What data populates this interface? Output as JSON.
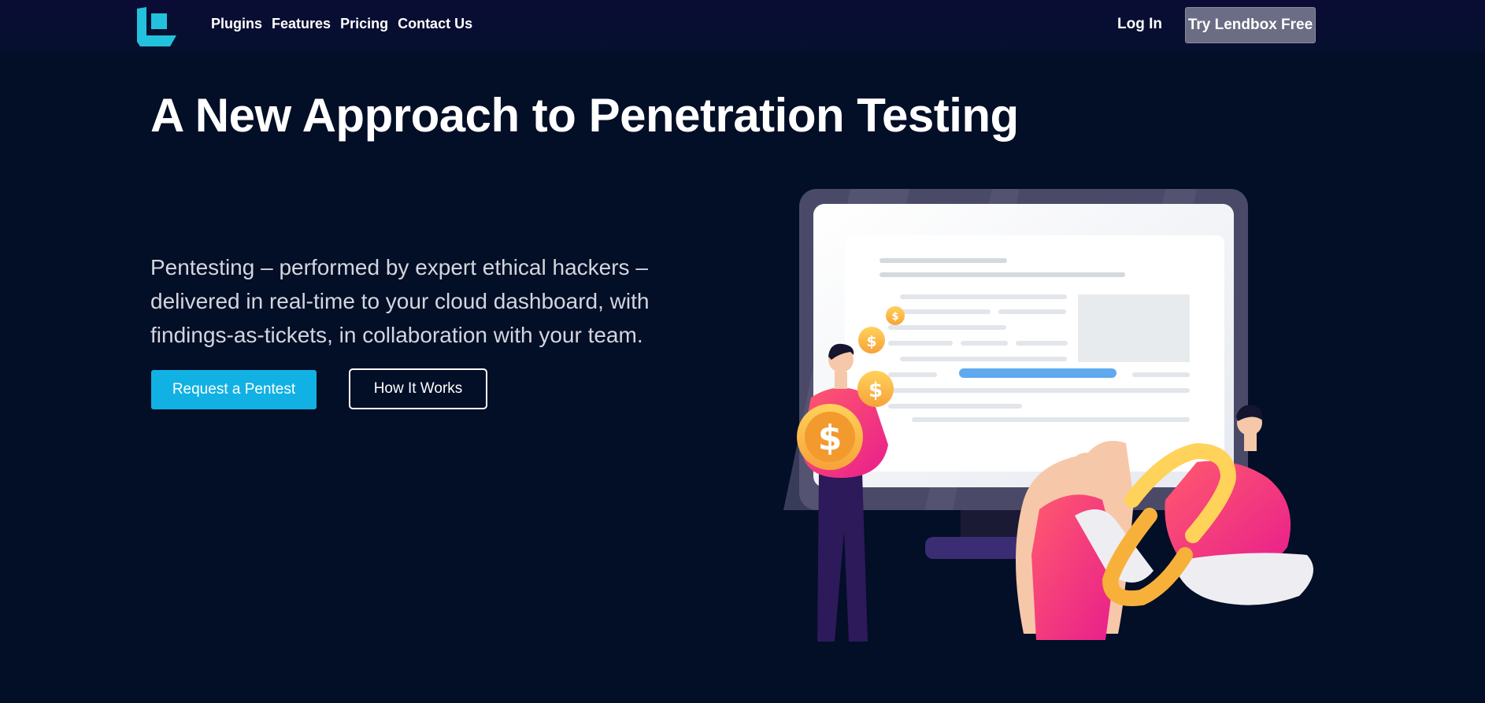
{
  "header": {
    "nav": [
      "Plugins",
      "Features",
      "Pricing",
      "Contact Us"
    ],
    "login_label": "Log In",
    "cta_label": "Try Lendbox Free"
  },
  "hero": {
    "title": "A New Approach to Penetration Testing",
    "subtitle": "Pentesting – performed by expert ethical hackers – delivered in real-time to your cloud dashboard, with findings-as-tickets, in collaboration with your team.",
    "primary_button": "Request a Pentest",
    "secondary_button": "How It Works"
  },
  "illustration": {
    "coin_symbol": "$"
  },
  "colors": {
    "background": "#030e27",
    "accent": "#11b1e3",
    "logo": "#22c2dc",
    "cta_background": "#6b6d84"
  }
}
